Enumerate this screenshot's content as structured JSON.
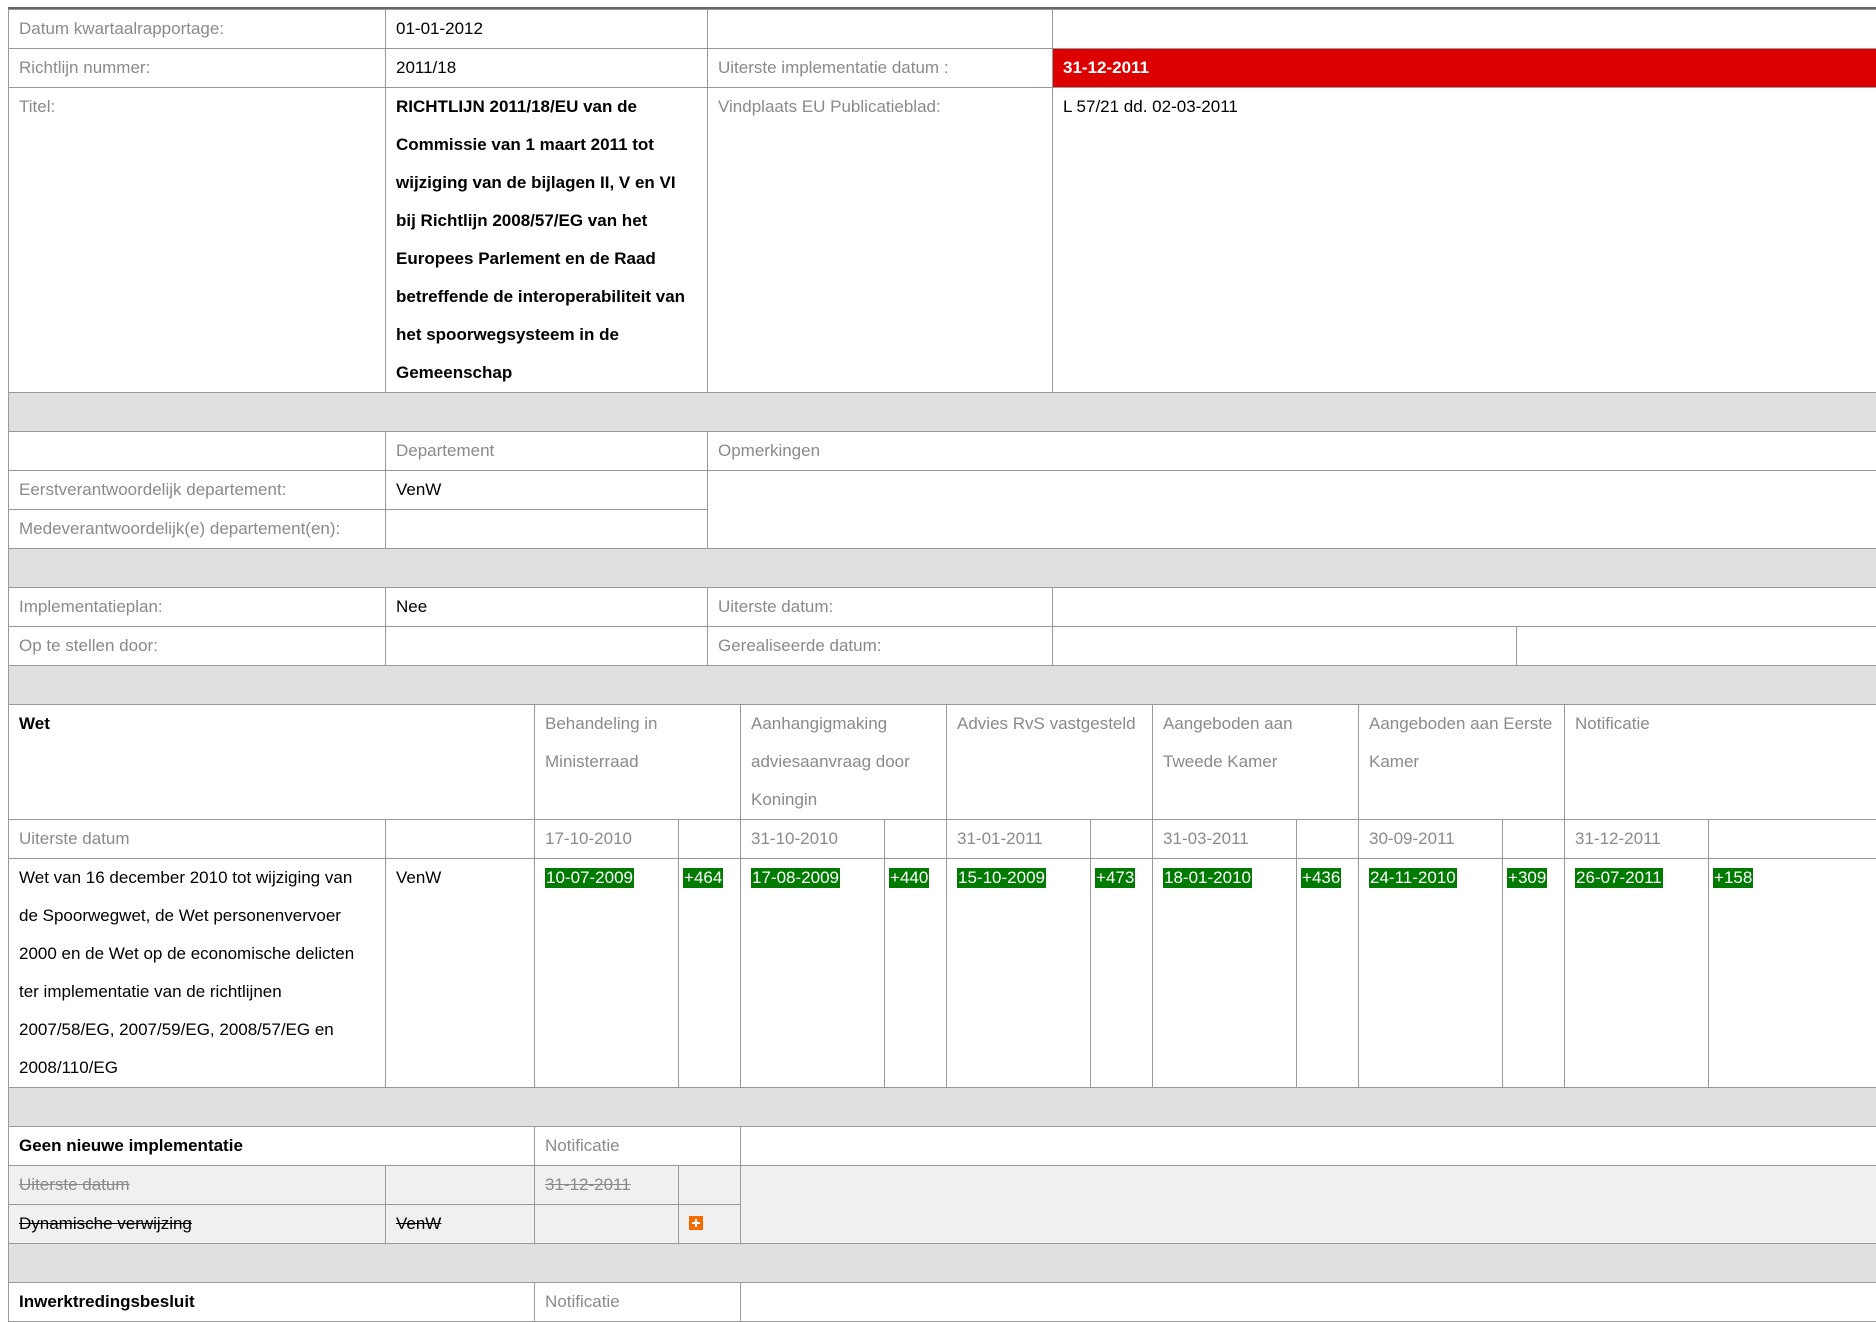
{
  "top": {
    "datum_label": "Datum kwartaalrapportage:",
    "datum_value": "01-01-2012",
    "richtlijn_label": "Richtlijn nummer:",
    "richtlijn_value": "2011/18",
    "uiterste_impl_label": "Uiterste implementatie datum :",
    "uiterste_impl_value": "31-12-2011",
    "titel_label": "Titel:",
    "titel_value": "RICHTLIJN 2011/18/EU van de Commissie van 1 maart 2011 tot wijziging van de bijlagen II, V en VI bij Richtlijn 2008/57/EG van het Europees Parlement en de Raad betreffende de interoperabiliteit van het spoorwegsysteem in de Gemeenschap",
    "vindplaats_label": "Vindplaats EU Publicatieblad:",
    "vindplaats_value": "L 57/21 dd. 02-03-2011"
  },
  "dept": {
    "col_departement": "Departement",
    "col_opmerkingen": "Opmerkingen",
    "eerst_label": "Eerstverantwoordelijk departement:",
    "eerst_value": "VenW",
    "mede_label": "Medeverantwoordelijk(e) departement(en):",
    "mede_value": ""
  },
  "plan": {
    "impl_label": "Implementatieplan:",
    "impl_value": "Nee",
    "uiterste_label": "Uiterste datum:",
    "op_label": "Op te stellen door:",
    "gereal_label": "Gerealiseerde datum:"
  },
  "wet": {
    "heading": "Wet",
    "columns": [
      "Behandeling in Ministerraad",
      "Aanhangigmaking adviesaanvraag door Koningin",
      "Advies RvS vastgesteld",
      "Aangeboden aan Tweede Kamer",
      "Aangeboden aan Eerste Kamer",
      "Notificatie"
    ],
    "uiterste_label": "Uiterste datum",
    "deadlines": [
      "17-10-2010",
      "31-10-2010",
      "31-01-2011",
      "31-03-2011",
      "30-09-2011",
      "31-12-2011"
    ],
    "row_title": "Wet van 16 december 2010 tot wijziging van de Spoorwegwet, de Wet personenvervoer 2000 en de Wet op de economische delicten ter implementatie van de richtlijnen 2007/58/EG, 2007/59/EG, 2008/57/EG en 2008/110/EG",
    "row_dept": "VenW",
    "actual": [
      "10-07-2009",
      "17-08-2009",
      "15-10-2009",
      "18-01-2010",
      "24-11-2010",
      "26-07-2011"
    ],
    "deltas": [
      "+464",
      "+440",
      "+473",
      "+436",
      "+309",
      "+158"
    ]
  },
  "geen": {
    "heading": "Geen nieuwe implementatie",
    "col_notificatie": "Notificatie",
    "uiterste_label": "Uiterste datum",
    "uiterste_value": "31-12-2011",
    "dyn_label": "Dynamische verwijzing",
    "dyn_dept": "VenW"
  },
  "inwerk": {
    "heading": "Inwerktredingsbesluit",
    "col_notificatie": "Notificatie"
  },
  "colors": {
    "red": "#dd0000",
    "green": "#007a00",
    "orange": "#f26a00",
    "separator": "#e0e0e0"
  }
}
